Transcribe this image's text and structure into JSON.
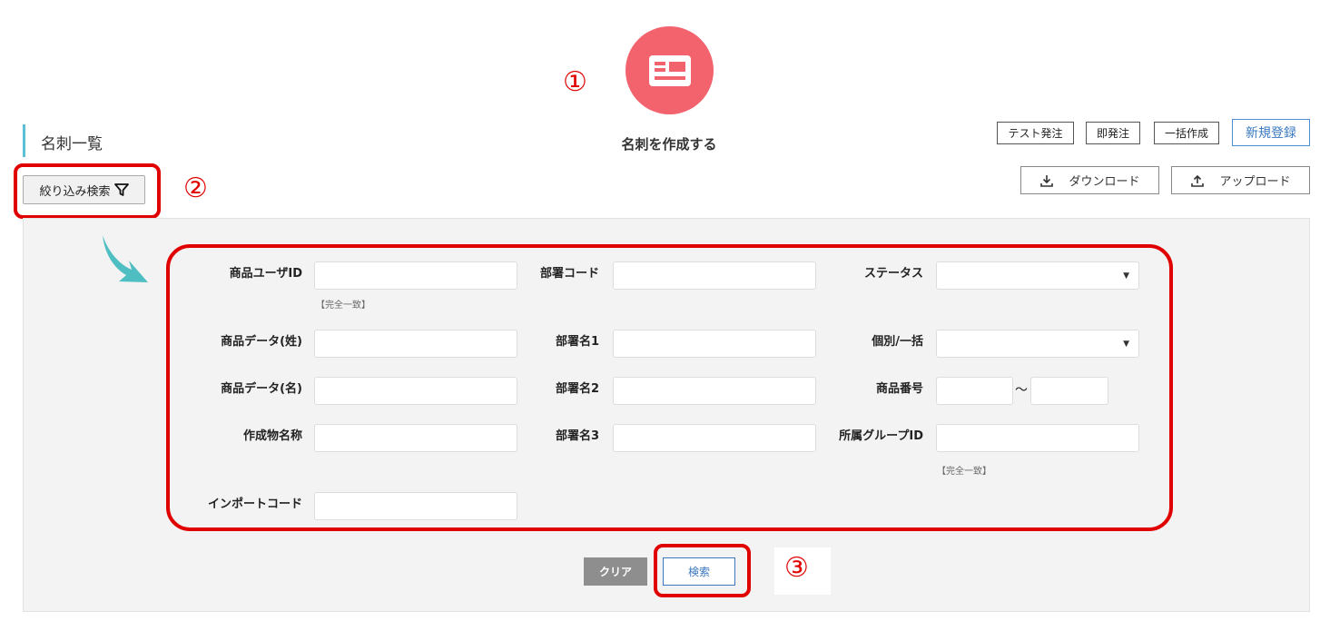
{
  "header": {
    "create_label": "名刺を作成する",
    "page_title": "名刺一覧",
    "create_icon": "business-card-icon"
  },
  "toolbar": {
    "test_order": "テスト発注",
    "instant_order": "即発注",
    "bulk_create": "一括作成",
    "new_register": "新規登録",
    "download": "ダウンロード",
    "upload": "アップロード"
  },
  "filter_toggle": {
    "label": "絞り込み検索",
    "icon": "filter-icon"
  },
  "annotations": {
    "one": "①",
    "two": "②",
    "three": "③"
  },
  "form": {
    "product_user_id": {
      "label": "商品ユーザID",
      "note": "【完全一致】",
      "value": ""
    },
    "dept_code": {
      "label": "部署コード",
      "value": ""
    },
    "status": {
      "label": "ステータス",
      "value": ""
    },
    "product_data_last": {
      "label": "商品データ(姓)",
      "value": ""
    },
    "dept_name1": {
      "label": "部署名1",
      "value": ""
    },
    "individual_bulk": {
      "label": "個別/一括",
      "value": ""
    },
    "product_data_first": {
      "label": "商品データ(名)",
      "value": ""
    },
    "dept_name2": {
      "label": "部署名2",
      "value": ""
    },
    "product_number": {
      "label": "商品番号",
      "separator": "～",
      "from": "",
      "to": ""
    },
    "creation_name": {
      "label": "作成物名称",
      "value": ""
    },
    "dept_name3": {
      "label": "部署名3",
      "value": ""
    },
    "group_id": {
      "label": "所属グループID",
      "note": "【完全一致】",
      "value": ""
    },
    "import_code": {
      "label": "インポートコード",
      "value": ""
    }
  },
  "actions": {
    "clear": "クリア",
    "search": "検索"
  },
  "colors": {
    "accent_red": "#e00000",
    "icon_bg": "#f2636e",
    "title_bar": "#5bc0d6",
    "arrow": "#4fbec3"
  }
}
